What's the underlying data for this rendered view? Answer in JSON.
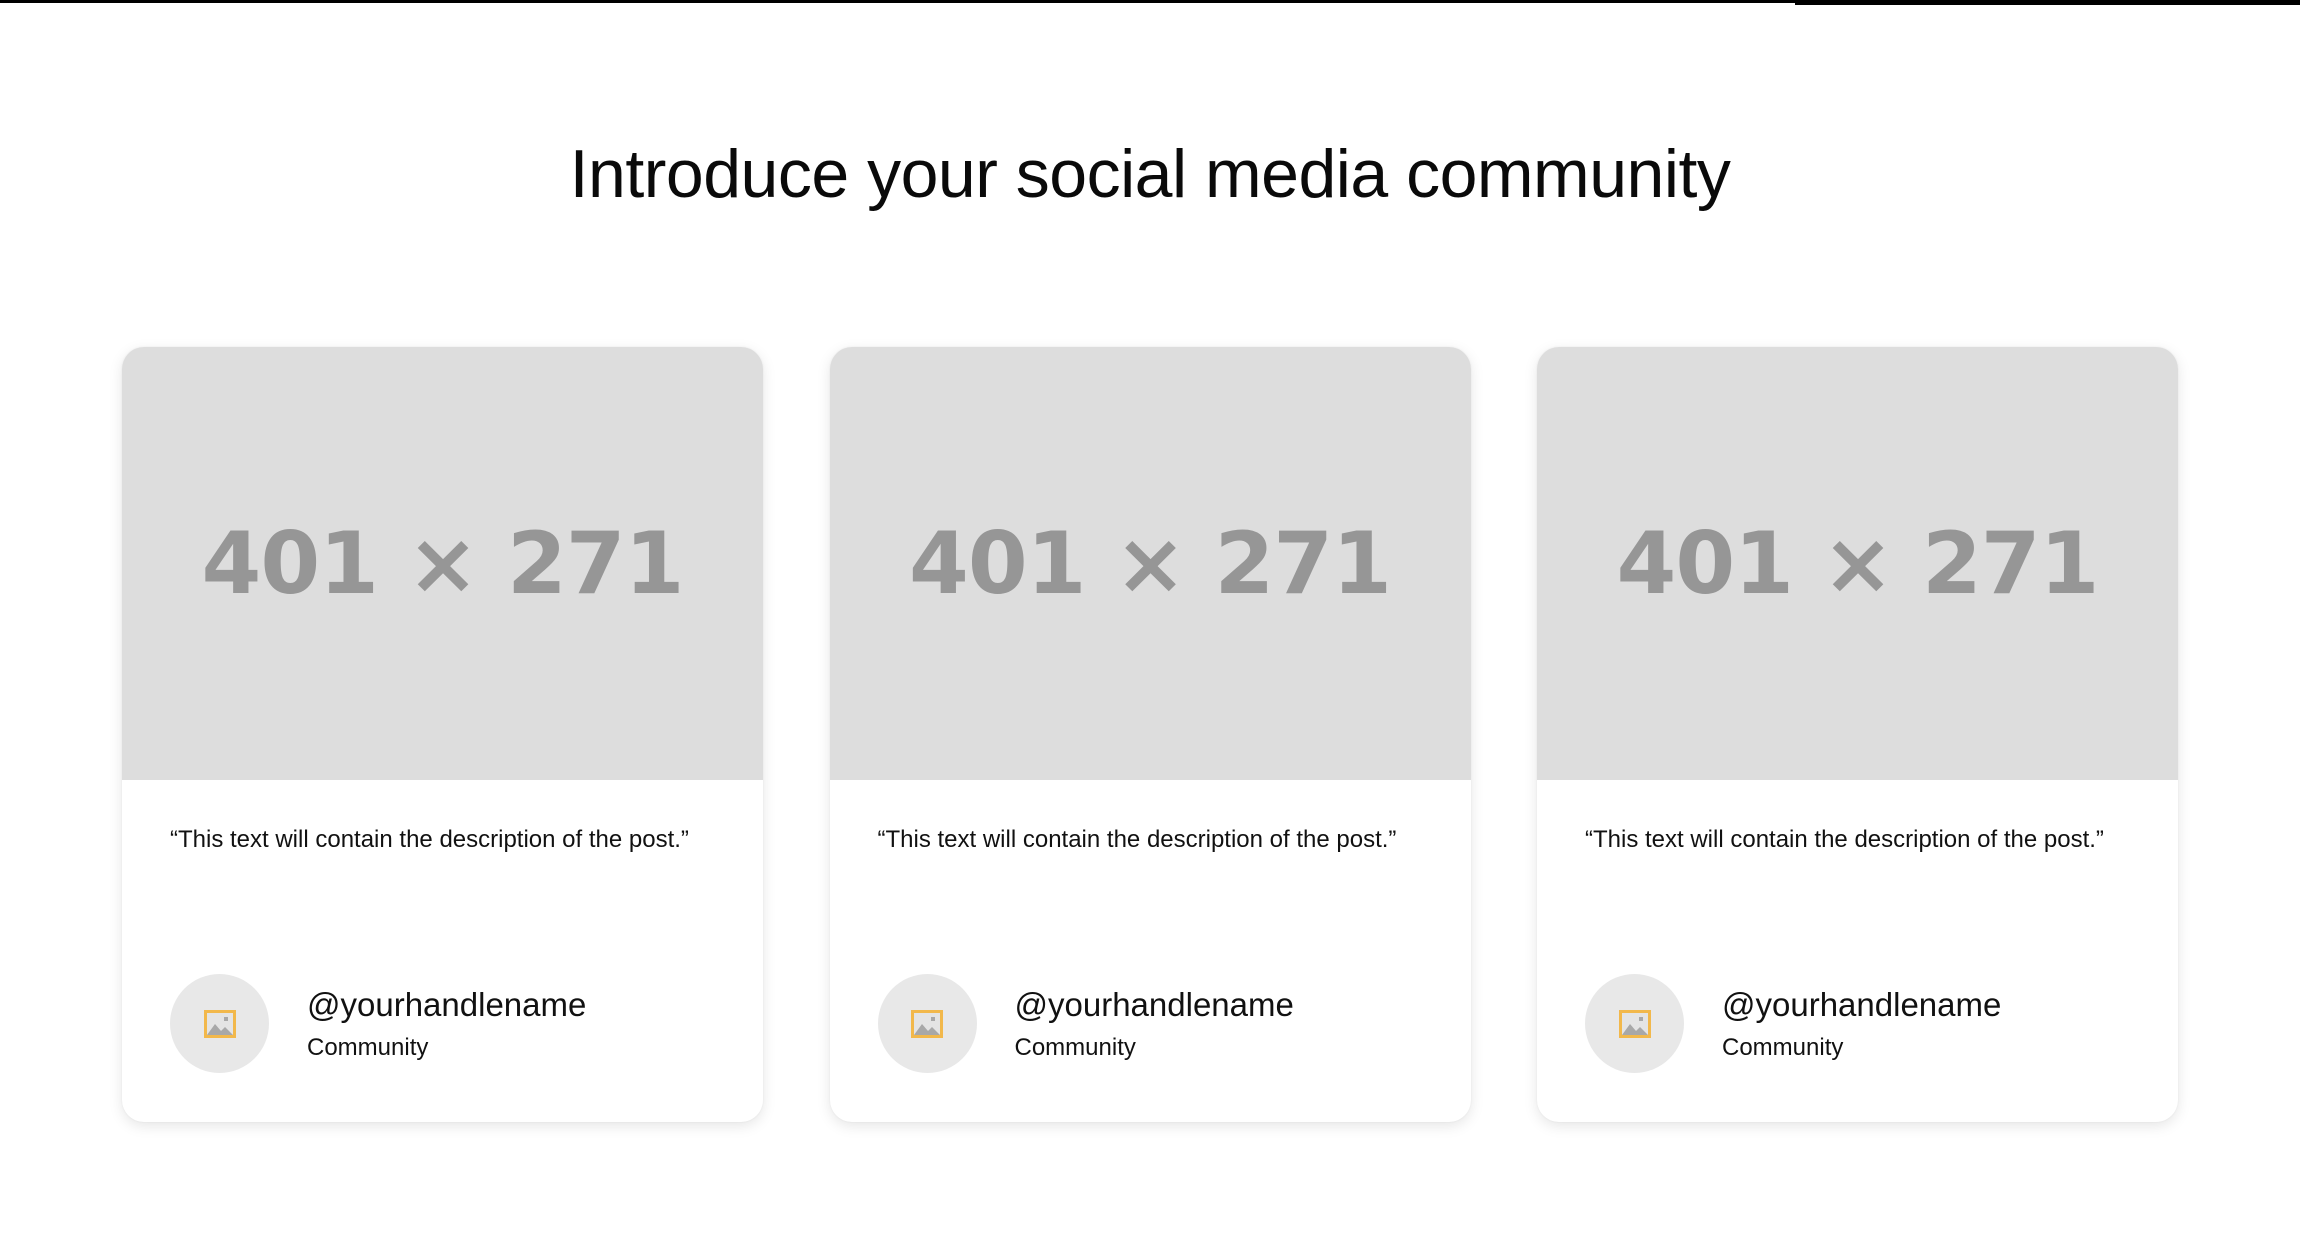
{
  "header": {
    "title": "Introduce your social media community"
  },
  "cards": [
    {
      "image_placeholder": "401 × 271",
      "description": "“This text will contain the description of the post.”",
      "handle": "@yourhandlename",
      "subtitle": "Community",
      "avatar_icon": "image-placeholder-icon"
    },
    {
      "image_placeholder": "401 × 271",
      "description": "“This text will contain the description of the post.”",
      "handle": "@yourhandlename",
      "subtitle": "Community",
      "avatar_icon": "image-placeholder-icon"
    },
    {
      "image_placeholder": "401 × 271",
      "description": "“This text will contain the description of the post.”",
      "handle": "@yourhandlename",
      "subtitle": "Community",
      "avatar_icon": "image-placeholder-icon"
    }
  ],
  "colors": {
    "image_placeholder_bg": "#dddddd",
    "image_placeholder_text": "#969696",
    "avatar_bg": "#e8e8e8",
    "avatar_icon": "#f2b84b"
  }
}
